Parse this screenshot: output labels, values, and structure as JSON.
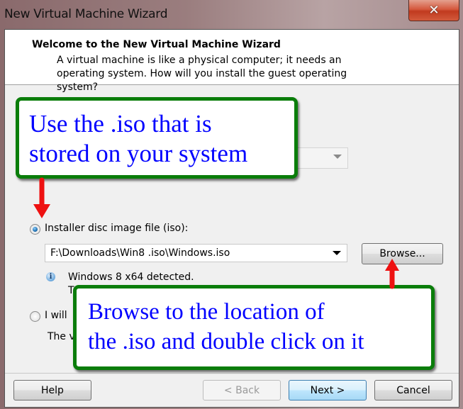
{
  "window": {
    "title": "New Virtual Machine Wizard",
    "close_icon": "close-icon"
  },
  "header": {
    "title": "Welcome to the New Virtual Machine Wizard",
    "description": "A virtual machine is like a physical computer; it needs an operating system. How will you install the guest operating system?"
  },
  "options": {
    "installer_disc_image": {
      "label": "Installer disc image file (iso):",
      "selected": true,
      "path_value": "F:\\Downloads\\Win8 .iso\\Windows.iso",
      "browse_label": "Browse...",
      "info_icon": "info-icon",
      "detected_text": "Windows 8 x64 detected.",
      "detected_text_2_partial": "T"
    },
    "install_later": {
      "label_partial": "I will",
      "selected": false,
      "desc_partial": "The v"
    }
  },
  "annotations": {
    "callout_top": {
      "line1": "Use the .iso that is",
      "line2": "stored on your system"
    },
    "callout_bottom": {
      "line1": "Browse to the location of",
      "line2": "the .iso and double click on it"
    },
    "arrow_color": "#ee1111",
    "border_color": "#0a7d0a",
    "text_color": "#0000ff"
  },
  "footer": {
    "help_label": "Help",
    "back_label": "< Back",
    "next_label": "Next >",
    "cancel_label": "Cancel"
  }
}
